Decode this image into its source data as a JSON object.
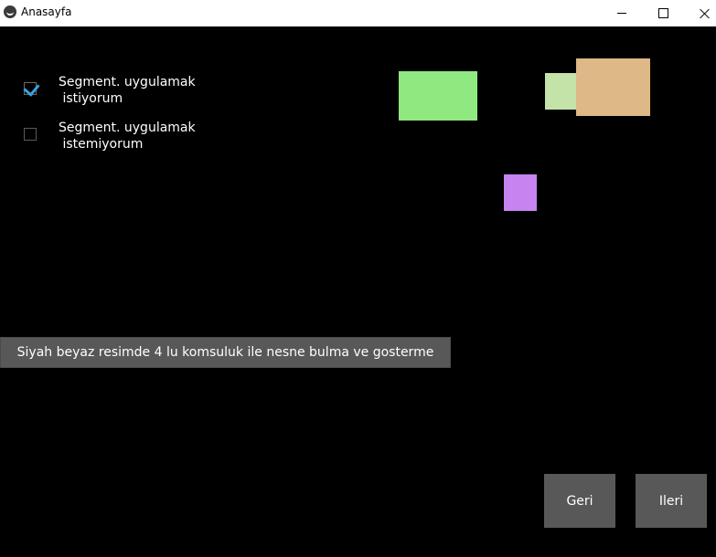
{
  "window": {
    "title": "Anasayfa",
    "icon": "kivy-icon",
    "controls": [
      "minimize",
      "maximize",
      "close"
    ]
  },
  "options": [
    {
      "label": "Segment. uygulamak\n istiyorum",
      "checked": true
    },
    {
      "label": "Segment. uygulamak\n istemiyorum",
      "checked": false
    }
  ],
  "shapes": {
    "colors": [
      "#90e880",
      "#c3e3a8",
      "#deb887",
      "#c783f0"
    ]
  },
  "main_button": {
    "label": "Siyah beyaz resimde 4 lu komsuluk ile nesne bulma ve gosterme"
  },
  "nav": {
    "back_label": "Geri",
    "next_label": "Ileri"
  },
  "colors": {
    "background": "#000000",
    "button": "#585858",
    "checkbox_accent": "#39a0de"
  }
}
